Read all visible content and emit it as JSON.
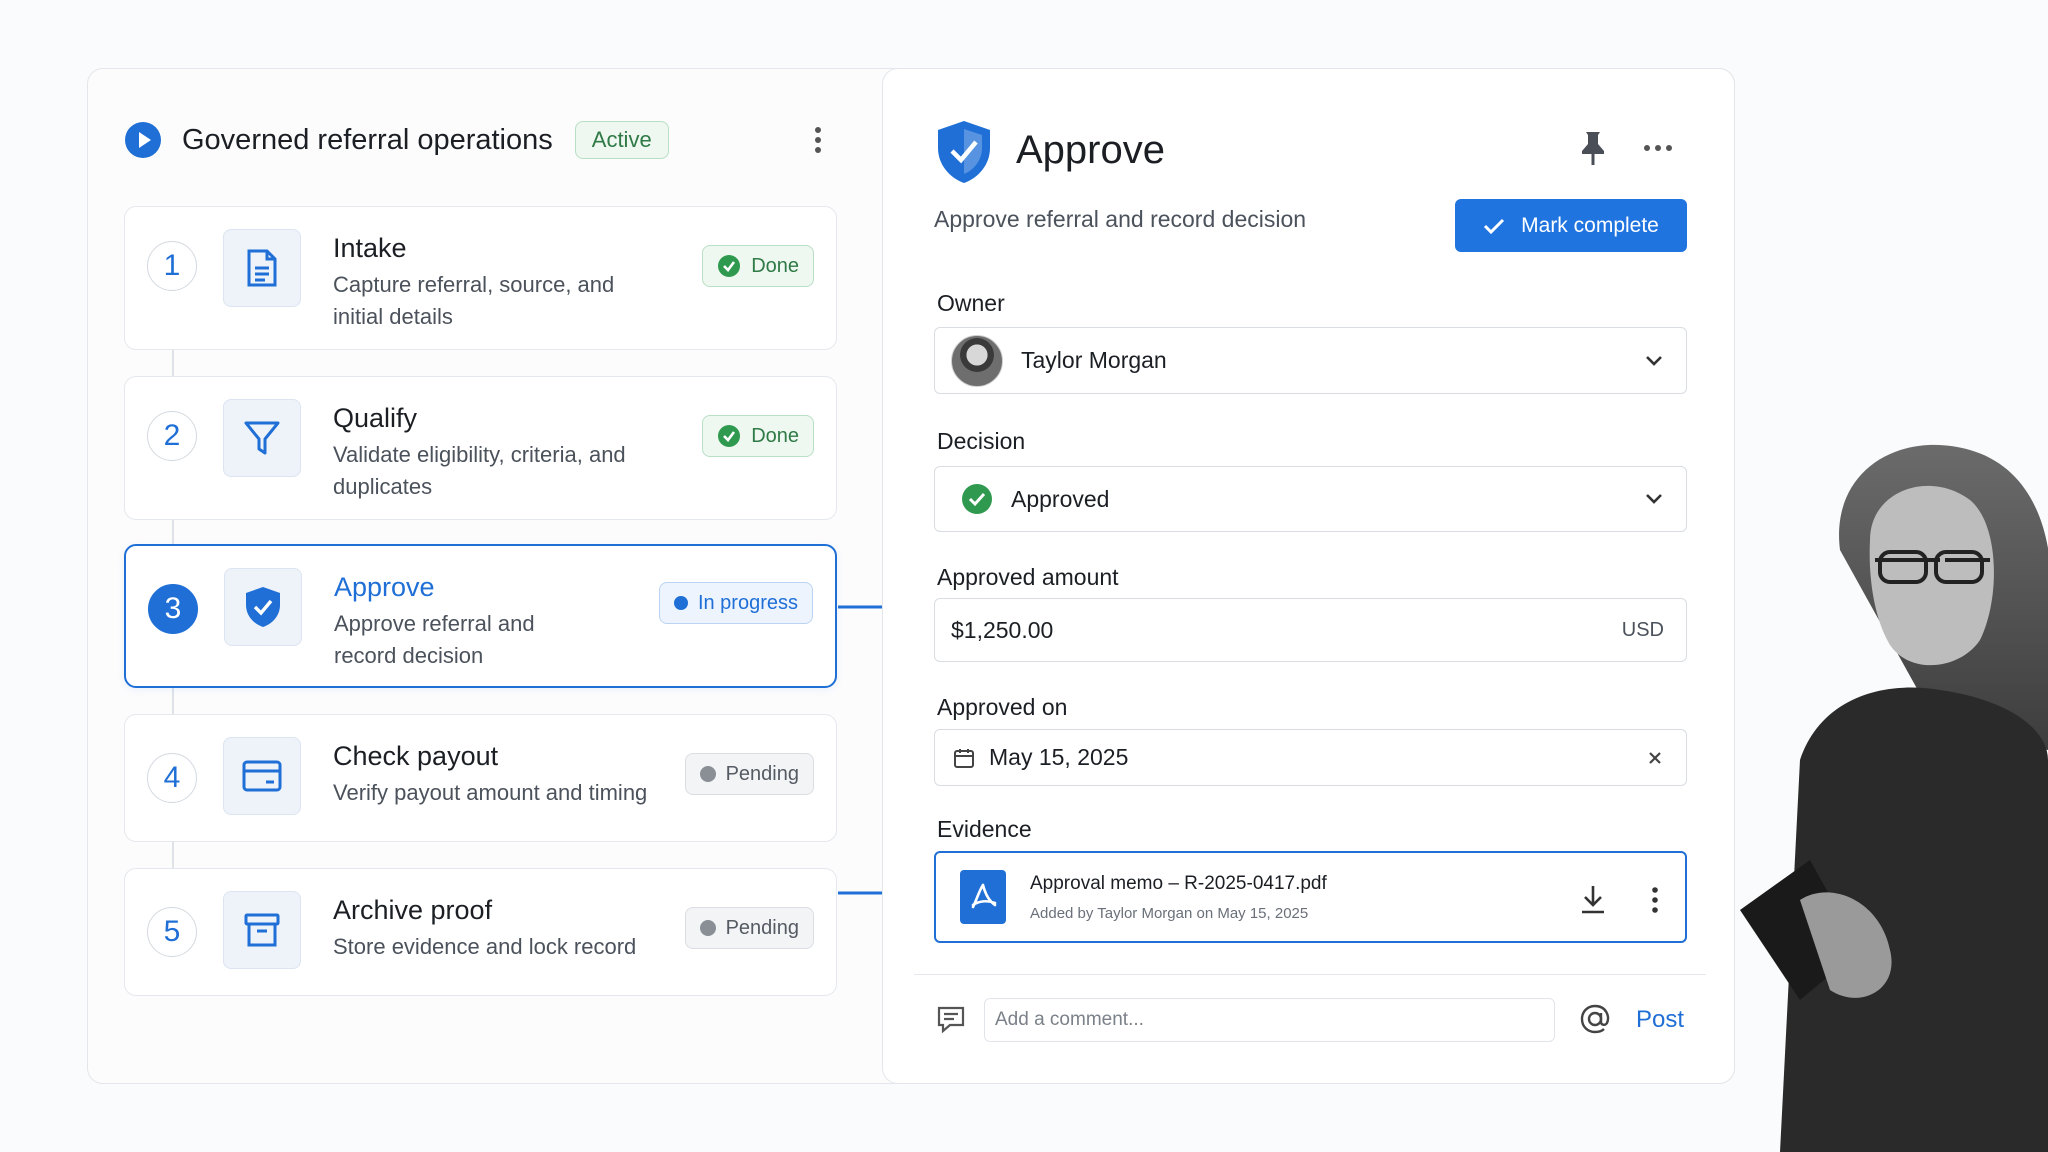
{
  "workflow": {
    "title": "Governed referral operations",
    "status": "Active"
  },
  "steps": [
    {
      "number": "1",
      "title": "Intake",
      "description": "Capture referral, source, and initial details",
      "status": "Done",
      "icon": "document-icon"
    },
    {
      "number": "2",
      "title": "Qualify",
      "description": "Validate eligibility, criteria, and duplicates",
      "status": "Done",
      "icon": "filter-icon"
    },
    {
      "number": "3",
      "title": "Approve",
      "description": "Approve referral and record decision",
      "status": "In progress",
      "icon": "shield-check-icon"
    },
    {
      "number": "4",
      "title": "Check payout",
      "description": "Verify payout amount and timing",
      "status": "Pending",
      "icon": "card-icon"
    },
    {
      "number": "5",
      "title": "Archive proof",
      "description": "Store evidence and lock record",
      "status": "Pending",
      "icon": "archive-icon"
    }
  ],
  "detail": {
    "title": "Approve",
    "subtitle": "Approve referral and record decision",
    "mark_complete": "Mark complete",
    "owner": {
      "label": "Owner",
      "value": "Taylor Morgan"
    },
    "decision": {
      "label": "Decision",
      "value": "Approved"
    },
    "amount": {
      "label": "Approved amount",
      "value": "$1,250.00",
      "currency": "USD"
    },
    "approved_on": {
      "label": "Approved on",
      "value": "May 15, 2025"
    },
    "evidence": {
      "label": "Evidence",
      "file_name": "Approval memo – R-2025-0417.pdf",
      "meta": "Added by Taylor Morgan on May 15, 2025"
    },
    "comment": {
      "placeholder": "Add a comment...",
      "post": "Post"
    }
  },
  "colors": {
    "accent": "#1f6fd6",
    "done": "#2f9a4f",
    "pending": "#8a8f96"
  }
}
